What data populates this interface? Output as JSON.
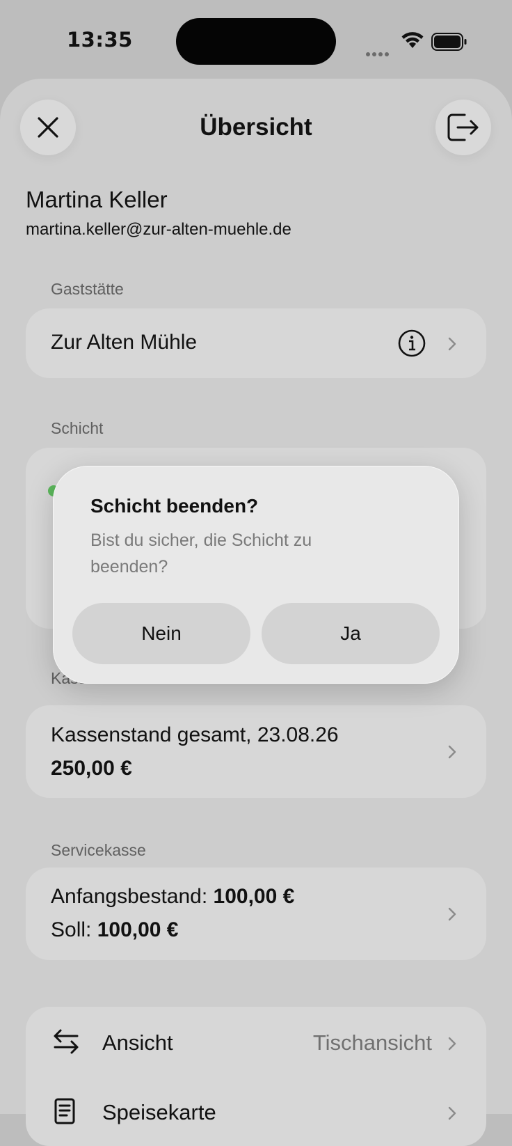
{
  "status_bar": {
    "time": "13:35"
  },
  "header": {
    "title": "Übersicht"
  },
  "user": {
    "name": "Martina Keller",
    "email": "martina.keller@zur-alten-muehle.de"
  },
  "gaststaette": {
    "label": "Gaststätte",
    "name": "Zur Alten Mühle"
  },
  "schicht": {
    "label": "Schicht",
    "status_color": "#5cb85c"
  },
  "kassenbuch": {
    "label": "Kassenbuch",
    "line1": "Kassenstand gesamt, 23.08.26",
    "amount": "250,00 €"
  },
  "servicekasse": {
    "label": "Servicekasse",
    "start_label": "Anfangsbestand: ",
    "start_value": "100,00 €",
    "soll_label": "Soll: ",
    "soll_value": "100,00 €"
  },
  "menu": {
    "items": [
      {
        "icon": "arrows-swap-icon",
        "label": "Ansicht",
        "value": "Tischansicht"
      },
      {
        "icon": "menu-card-icon",
        "label": "Speisekarte",
        "value": ""
      }
    ]
  },
  "dialog": {
    "title": "Schicht beenden?",
    "message": "Bist du sicher, die Schicht zu beenden?",
    "cancel_label": "Nein",
    "confirm_label": "Ja"
  }
}
